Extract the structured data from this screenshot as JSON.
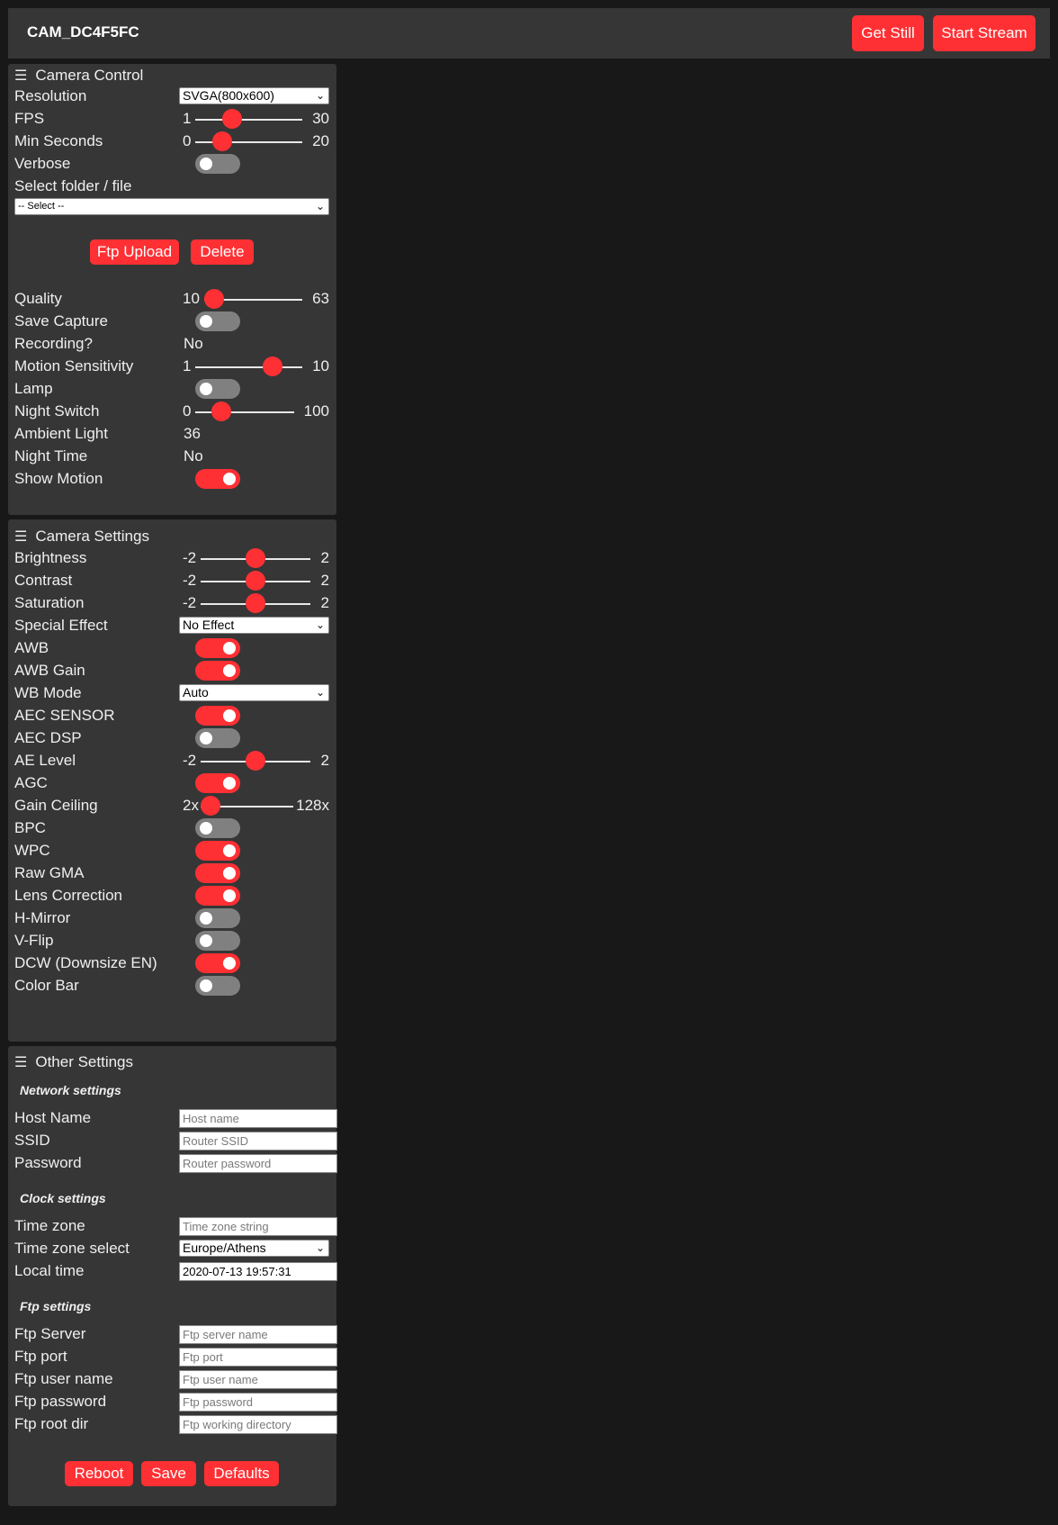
{
  "header": {
    "title": "CAM_DC4F5FC",
    "get_still": "Get Still",
    "start_stream": "Start Stream"
  },
  "camera_control": {
    "title": "Camera Control",
    "resolution": {
      "label": "Resolution",
      "value": "SVGA(800x600)"
    },
    "fps": {
      "label": "FPS",
      "min": "1",
      "max": "30",
      "value": 10
    },
    "min_seconds": {
      "label": "Min Seconds",
      "min": "0",
      "max": "20",
      "value": 4
    },
    "verbose": {
      "label": "Verbose",
      "on": false
    },
    "select_folder": {
      "label": "Select folder / file",
      "value": "-- Select --"
    },
    "ftp_upload": "Ftp Upload",
    "delete": "Delete",
    "quality": {
      "label": "Quality",
      "min": "10",
      "max": "63",
      "value": 10
    },
    "save_capture": {
      "label": "Save Capture",
      "on": false
    },
    "recording": {
      "label": "Recording?",
      "value": "No"
    },
    "motion_sensitivity": {
      "label": "Motion Sensitivity",
      "min": "1",
      "max": "10",
      "value": 8
    },
    "lamp": {
      "label": "Lamp",
      "on": false
    },
    "night_switch": {
      "label": "Night Switch",
      "min": "0",
      "max": "100",
      "value": 20
    },
    "ambient_light": {
      "label": "Ambient Light",
      "value": "36"
    },
    "night_time": {
      "label": "Night Time",
      "value": "No"
    },
    "show_motion": {
      "label": "Show Motion",
      "on": true
    }
  },
  "camera_settings": {
    "title": "Camera Settings",
    "brightness": {
      "label": "Brightness",
      "min": "-2",
      "max": "2",
      "value": 0
    },
    "contrast": {
      "label": "Contrast",
      "min": "-2",
      "max": "2",
      "value": 0
    },
    "saturation": {
      "label": "Saturation",
      "min": "-2",
      "max": "2",
      "value": 0
    },
    "special_effect": {
      "label": "Special Effect",
      "value": "No Effect"
    },
    "awb": {
      "label": "AWB",
      "on": true
    },
    "awb_gain": {
      "label": "AWB Gain",
      "on": true
    },
    "wb_mode": {
      "label": "WB Mode",
      "value": "Auto"
    },
    "aec_sensor": {
      "label": "AEC SENSOR",
      "on": true
    },
    "aec_dsp": {
      "label": "AEC DSP",
      "on": false
    },
    "ae_level": {
      "label": "AE Level",
      "min": "-2",
      "max": "2",
      "value": 0
    },
    "agc": {
      "label": "AGC",
      "on": true
    },
    "gain_ceiling": {
      "label": "Gain Ceiling",
      "min": "2x",
      "max": "128x",
      "value": 0
    },
    "bpc": {
      "label": "BPC",
      "on": false
    },
    "wpc": {
      "label": "WPC",
      "on": true
    },
    "raw_gma": {
      "label": "Raw GMA",
      "on": true
    },
    "lens_correction": {
      "label": "Lens Correction",
      "on": true
    },
    "h_mirror": {
      "label": "H-Mirror",
      "on": false
    },
    "v_flip": {
      "label": "V-Flip",
      "on": false
    },
    "dcw": {
      "label": "DCW (Downsize EN)",
      "on": true
    },
    "color_bar": {
      "label": "Color Bar",
      "on": false
    }
  },
  "other_settings": {
    "title": "Other Settings",
    "network_heading": "Network settings",
    "host_name": {
      "label": "Host Name",
      "placeholder": "Host name"
    },
    "ssid": {
      "label": "SSID",
      "placeholder": "Router SSID"
    },
    "password": {
      "label": "Password",
      "placeholder": "Router password"
    },
    "clock_heading": "Clock settings",
    "time_zone": {
      "label": "Time zone",
      "placeholder": "Time zone string"
    },
    "time_zone_select": {
      "label": "Time zone select",
      "value": "Europe/Athens"
    },
    "local_time": {
      "label": "Local time",
      "value": "2020-07-13 19:57:31"
    },
    "ftp_heading": "Ftp settings",
    "ftp_server": {
      "label": "Ftp Server",
      "placeholder": "Ftp server name"
    },
    "ftp_port": {
      "label": "Ftp port",
      "placeholder": "Ftp port"
    },
    "ftp_user": {
      "label": "Ftp user name",
      "placeholder": "Ftp user name"
    },
    "ftp_password": {
      "label": "Ftp password",
      "placeholder": "Ftp password"
    },
    "ftp_root": {
      "label": "Ftp root dir",
      "placeholder": "Ftp working directory"
    },
    "reboot": "Reboot",
    "save": "Save",
    "defaults": "Defaults"
  },
  "colors": {
    "accent": "#ff3034",
    "panel": "#363636",
    "background": "#181818",
    "toggle_off": "#808080"
  }
}
